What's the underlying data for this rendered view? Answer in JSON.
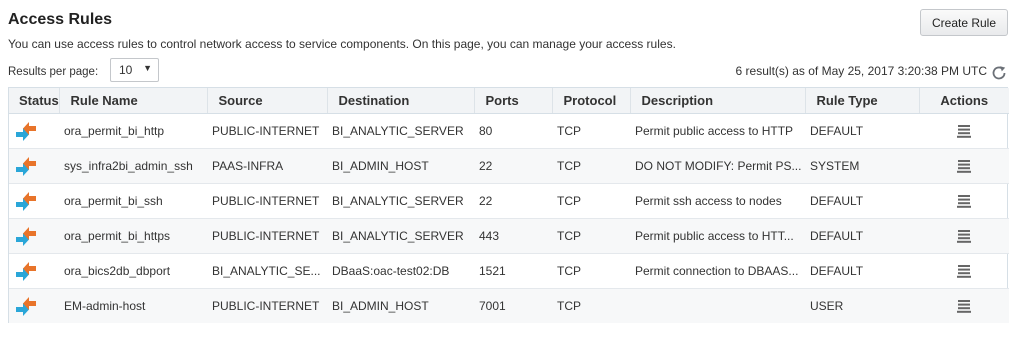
{
  "header": {
    "title": "Access Rules",
    "description": "You can use access rules to control network access to service components. On this page, you can manage your access rules.",
    "create_label": "Create Rule"
  },
  "paging": {
    "label": "Results per page:",
    "value": "10",
    "results_text": "6 result(s) as of May 25, 2017 3:20:38 PM UTC"
  },
  "columns": [
    "Status",
    "Rule Name",
    "Source",
    "Destination",
    "Ports",
    "Protocol",
    "Description",
    "Rule Type",
    "Actions"
  ],
  "rows": [
    {
      "name": "ora_permit_bi_http",
      "source": "PUBLIC-INTERNET",
      "destination": "BI_ANALYTIC_SERVER",
      "ports": "80",
      "protocol": "TCP",
      "description": "Permit public access to HTTP",
      "type": "DEFAULT"
    },
    {
      "name": "sys_infra2bi_admin_ssh",
      "source": "PAAS-INFRA",
      "destination": "BI_ADMIN_HOST",
      "ports": "22",
      "protocol": "TCP",
      "description": "DO NOT MODIFY: Permit PS...",
      "type": "SYSTEM"
    },
    {
      "name": "ora_permit_bi_ssh",
      "source": "PUBLIC-INTERNET",
      "destination": "BI_ANALYTIC_SERVER",
      "ports": "22",
      "protocol": "TCP",
      "description": "Permit ssh access to nodes",
      "type": "DEFAULT"
    },
    {
      "name": "ora_permit_bi_https",
      "source": "PUBLIC-INTERNET",
      "destination": "BI_ANALYTIC_SERVER",
      "ports": "443",
      "protocol": "TCP",
      "description": "Permit public access to HTT...",
      "type": "DEFAULT"
    },
    {
      "name": "ora_bics2db_dbport",
      "source": "BI_ANALYTIC_SE...",
      "destination": "DBaaS:oac-test02:DB",
      "ports": "1521",
      "protocol": "TCP",
      "description": "Permit connection to DBAAS...",
      "type": "DEFAULT"
    },
    {
      "name": "EM-admin-host",
      "source": "PUBLIC-INTERNET",
      "destination": "BI_ADMIN_HOST",
      "ports": "7001",
      "protocol": "TCP",
      "description": "",
      "type": "USER"
    }
  ],
  "icons": {
    "status": "in-out-arrows-icon",
    "actions": "hamburger-menu-icon",
    "refresh": "refresh-icon"
  },
  "colors": {
    "arrow_in": "#2aa6d8",
    "arrow_out": "#e8742a",
    "header_bg": "#f2f4f6"
  }
}
